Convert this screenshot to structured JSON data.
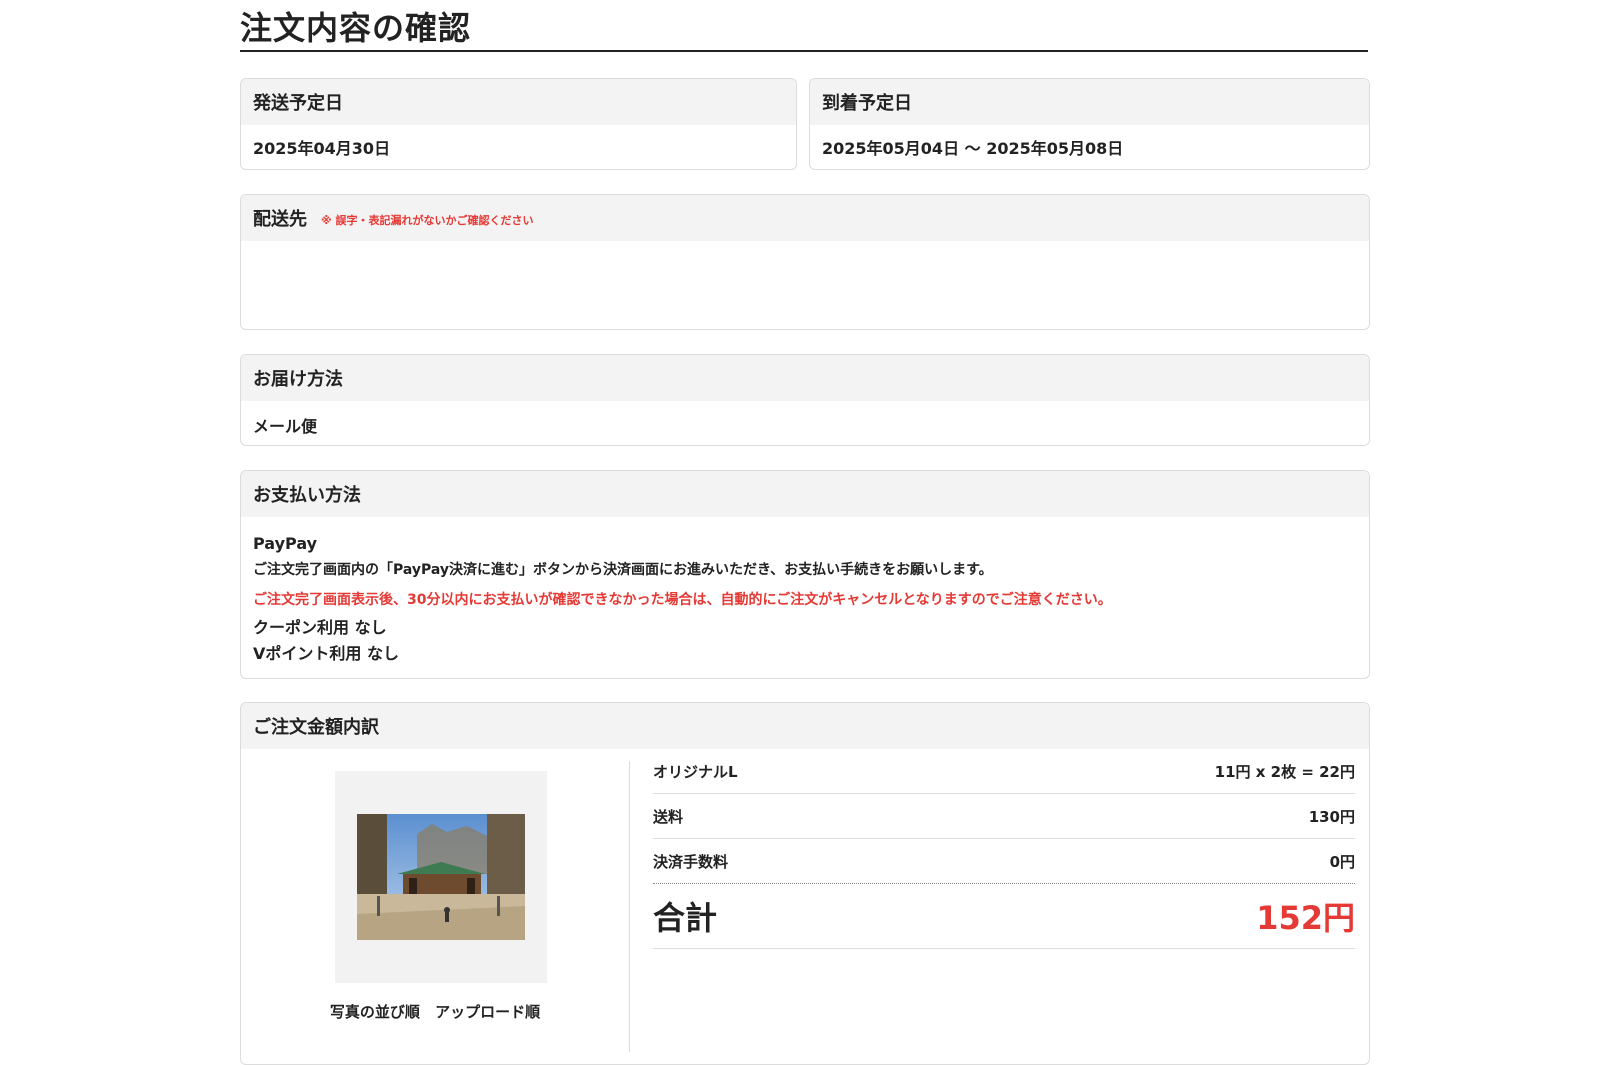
{
  "page": {
    "title": "注文内容の確認"
  },
  "ship_date": {
    "label": "発送予定日",
    "value": "2025年04月30日"
  },
  "arrival_date": {
    "label": "到着予定日",
    "value": "2025年05月04日 〜 2025年05月08日"
  },
  "destination": {
    "label": "配送先",
    "note": "※ 誤字・表記漏れがないかご確認ください",
    "value": ""
  },
  "delivery": {
    "label": "お届け方法",
    "value": "メール便"
  },
  "payment": {
    "label": "お支払い方法",
    "method": "PayPay",
    "instruction": "ご注文完了画面内の「PayPay決済に進む」ボタンから決済画面にお進みいただき、お支払い手続きをお願いします。",
    "warning": "ご注文完了画面表示後、30分以内にお支払いが確認できなかった場合は、自動的にご注文がキャンセルとなりますのでご注意ください。",
    "coupon": "クーポン利用 なし",
    "vpoint": "Vポイント利用 なし"
  },
  "breakdown": {
    "label": "ご注文金額内訳",
    "photo_order_label": "写真の並び順",
    "photo_order_value": "アップロード順",
    "rows": [
      {
        "label": "オリジナルL",
        "value": "11円 x 2枚 = 22円"
      },
      {
        "label": "送料",
        "value": "130円"
      },
      {
        "label": "決済手数料",
        "value": "0円"
      }
    ],
    "total_label": "合計",
    "total_value": "152円"
  },
  "colors": {
    "accent_red": "#e53935",
    "header_bg": "#f3f3f3",
    "border": "#dcdcdc"
  }
}
